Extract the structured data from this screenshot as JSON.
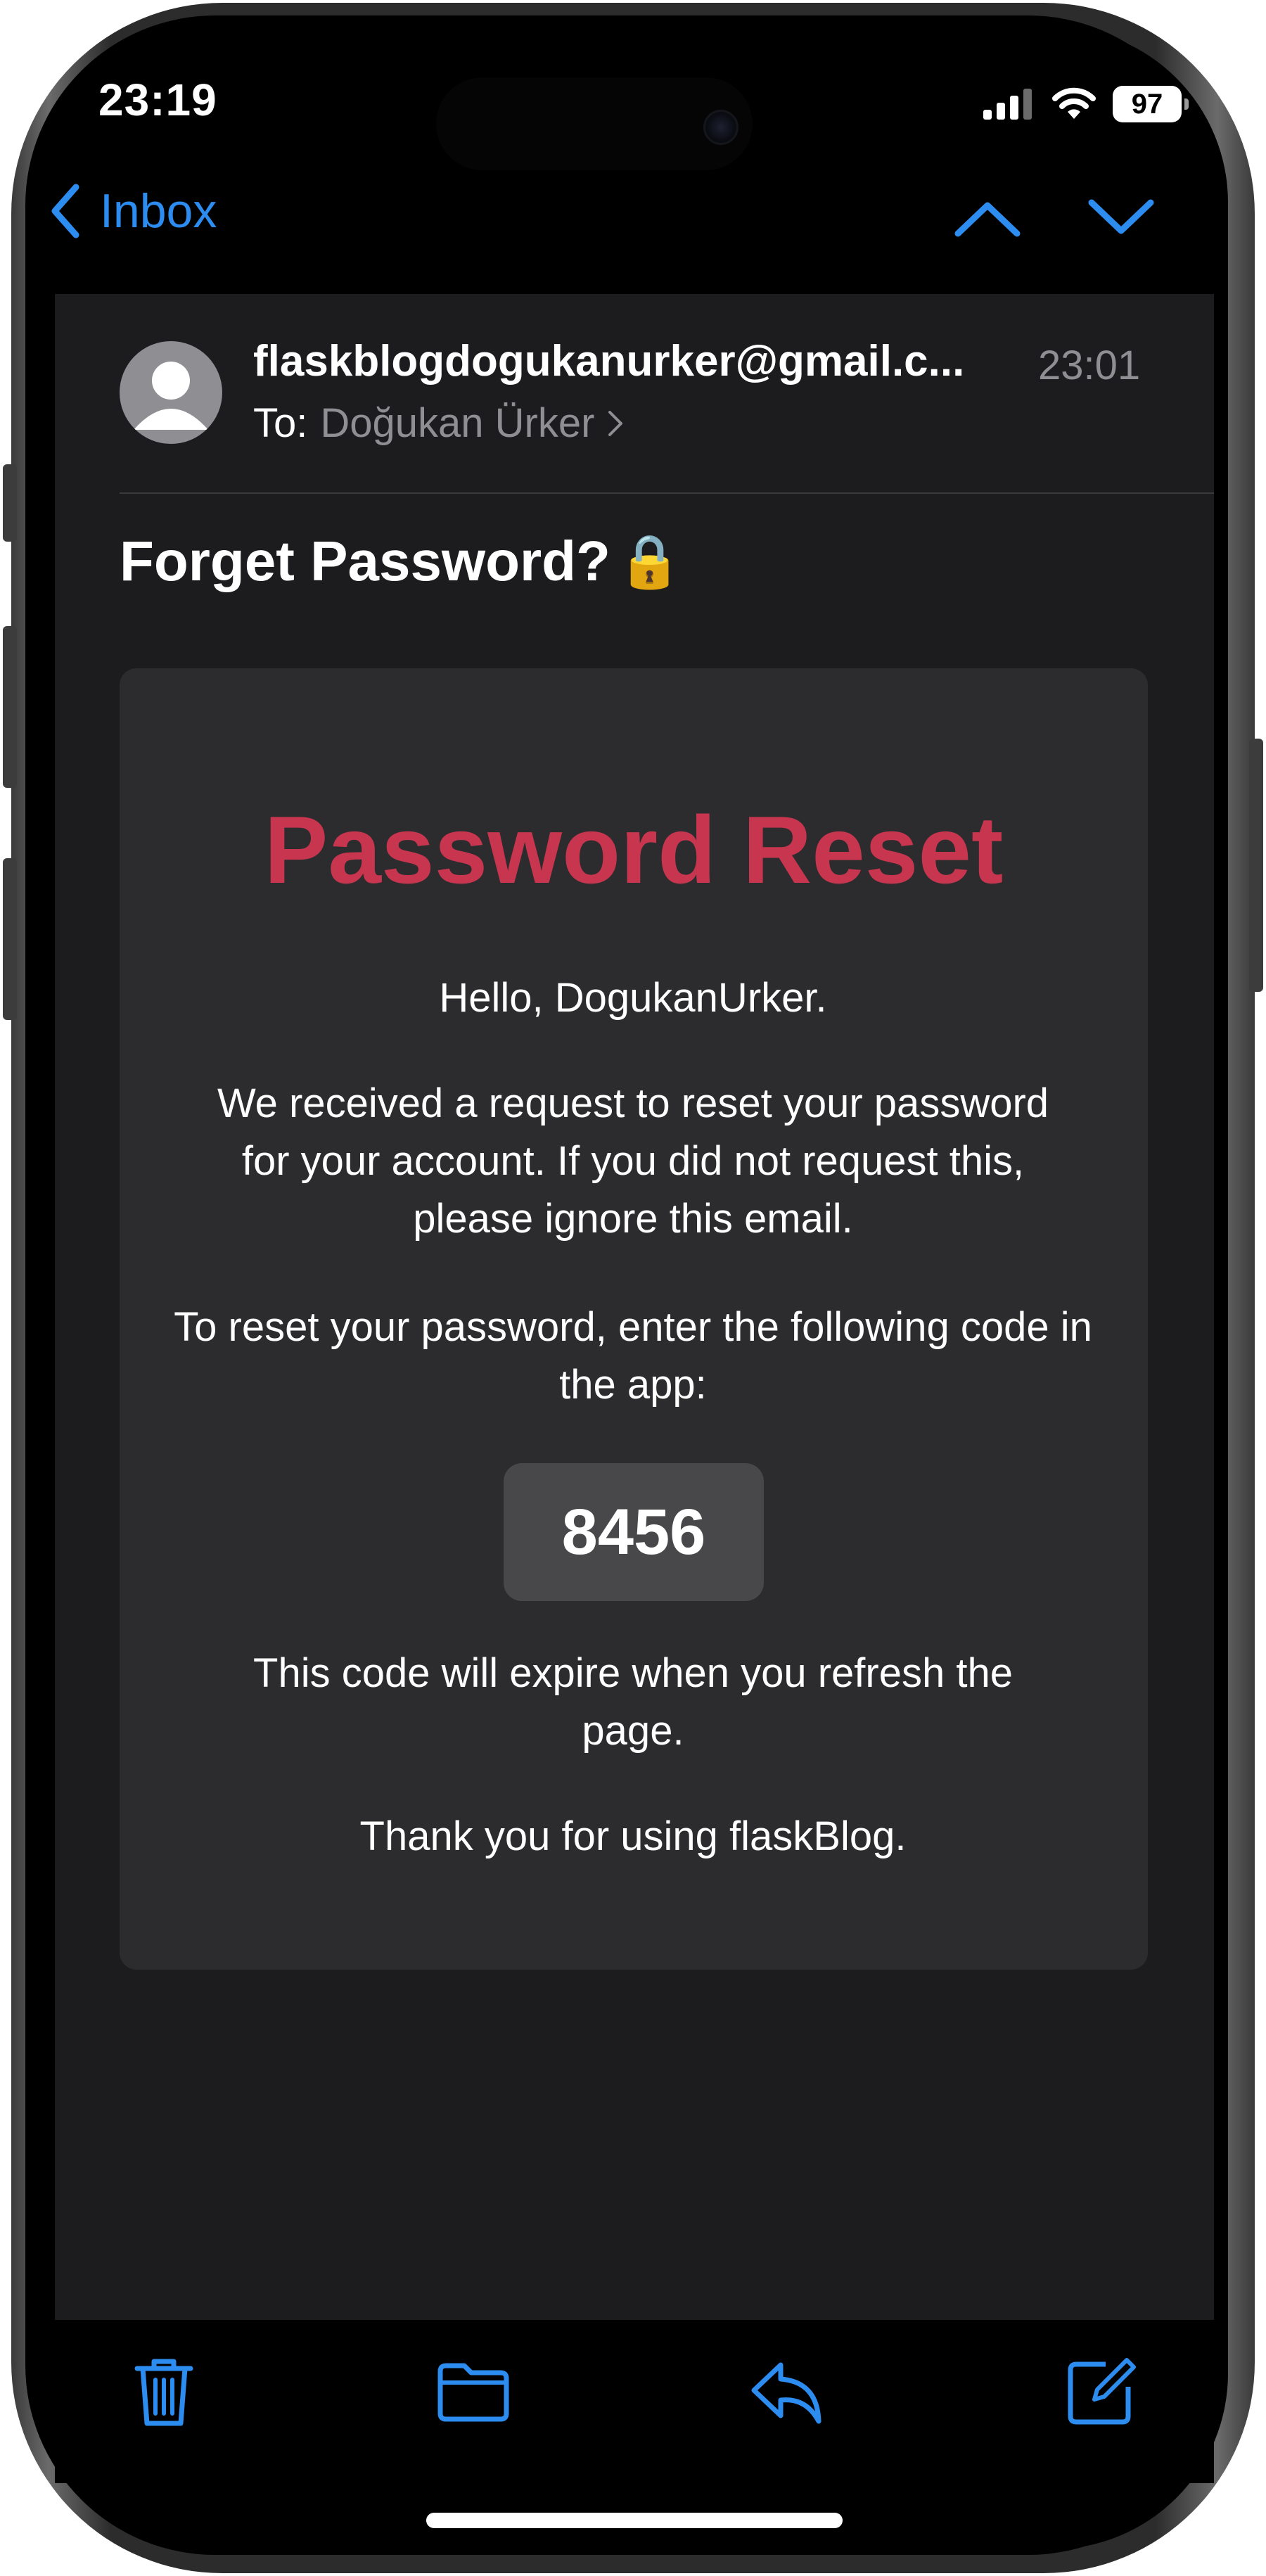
{
  "status_bar": {
    "time": "23:19",
    "battery": "97",
    "icons": [
      "cellular-signal-icon",
      "wifi-icon",
      "battery-icon"
    ]
  },
  "nav": {
    "back_label": "Inbox",
    "icons": [
      "chevron-left-icon",
      "chevron-up-icon",
      "chevron-down-icon"
    ]
  },
  "message": {
    "sender": "flaskblogdogukanurker@gmail.c...",
    "time": "23:01",
    "to_label": "To:",
    "to_name": "Doğukan Ürker",
    "subject": "Forget Password?",
    "subject_emoji": "🔒"
  },
  "email_body": {
    "title": "Password Reset",
    "greeting": "Hello, DogukanUrker.",
    "paragraph1": "We received a request to reset your password for your account. If you did not request this, please ignore this email.",
    "paragraph2": "To reset your password, enter the following code in the app:",
    "code": "8456",
    "paragraph3": "This code will expire when you refresh the page.",
    "closing": "Thank you for using flaskBlog."
  },
  "toolbar": {
    "icons": [
      "trash-icon",
      "folder-icon",
      "reply-icon",
      "compose-icon"
    ]
  },
  "colors": {
    "accent": "#2d8cf0",
    "title_red": "#c7354f",
    "card_bg": "#2c2c2e",
    "sheet_bg": "#1c1c1e"
  }
}
